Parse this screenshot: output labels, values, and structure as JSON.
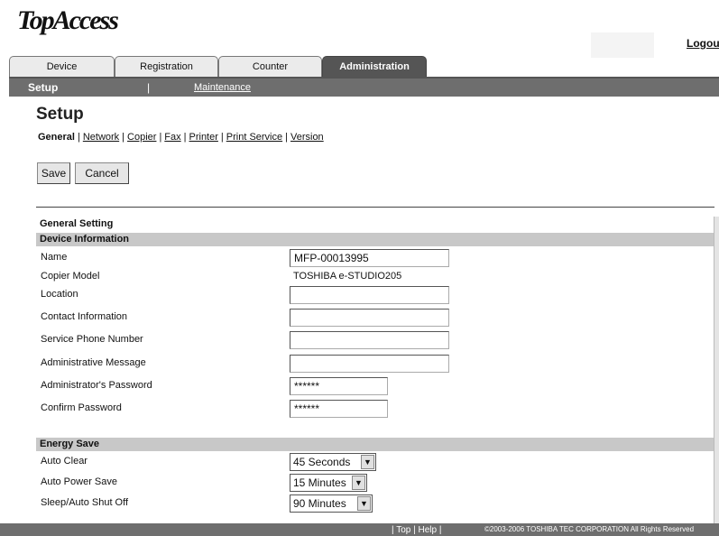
{
  "header": {
    "logo": "TopAccess",
    "logout": "Logout"
  },
  "tabs": [
    "Device",
    "Registration",
    "Counter",
    "Administration"
  ],
  "subnav": {
    "setup": "Setup",
    "sep": "|",
    "maintenance": "Maintenance"
  },
  "page": {
    "title": "Setup"
  },
  "links": [
    "General",
    "Network",
    "Copier",
    "Fax",
    "Printer",
    "Print Service",
    "Version"
  ],
  "buttons": {
    "save": "Save",
    "cancel": "Cancel"
  },
  "general": {
    "title": "General Setting",
    "device_info": "Device Information",
    "fields": {
      "name": {
        "label": "Name",
        "value": "MFP-00013995"
      },
      "copier_model": {
        "label": "Copier Model",
        "value": "TOSHIBA e-STUDIO205"
      },
      "location": {
        "label": "Location",
        "value": ""
      },
      "contact": {
        "label": "Contact Information",
        "value": ""
      },
      "service_phone": {
        "label": "Service Phone Number",
        "value": ""
      },
      "admin_message": {
        "label": "Administrative Message",
        "value": ""
      },
      "admin_password": {
        "label": "Administrator's Password",
        "value": "******"
      },
      "confirm_password": {
        "label": "Confirm Password",
        "value": "******"
      }
    }
  },
  "energy": {
    "title": "Energy Save",
    "auto_clear": {
      "label": "Auto Clear",
      "value": "45 Seconds"
    },
    "auto_power_save": {
      "label": "Auto Power Save",
      "value": "15 Minutes"
    },
    "sleep": {
      "label": "Sleep/Auto Shut Off",
      "value": "90 Minutes"
    }
  },
  "footer": {
    "links": "| Top | Help |",
    "copyright": "©2003-2006 TOSHIBA TEC CORPORATION All Rights Reserved"
  },
  "colors": {
    "dark_bar": "#6e6e6e",
    "section_bar": "#c8c8c8",
    "active_tab": "#555555"
  }
}
